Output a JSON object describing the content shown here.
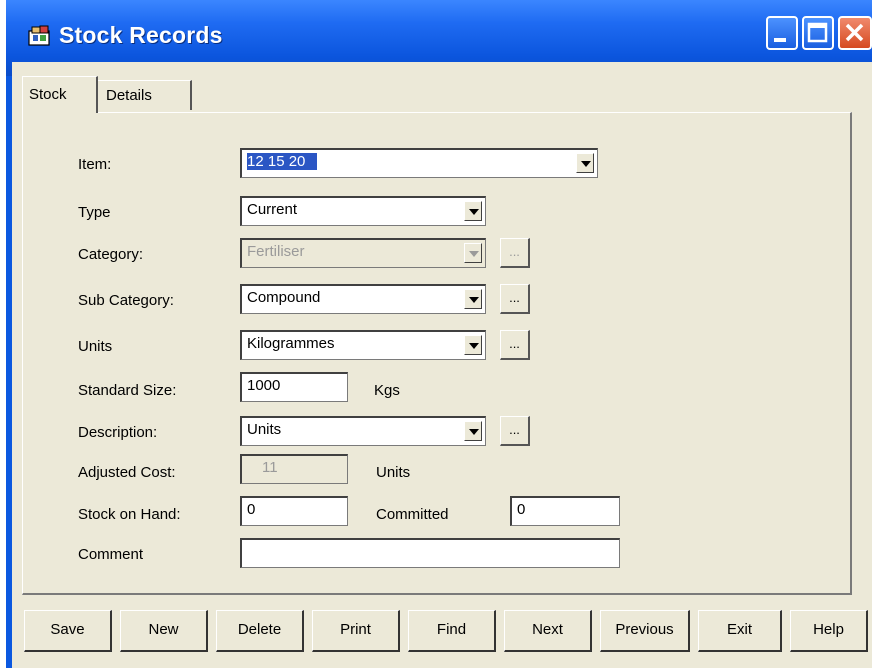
{
  "window": {
    "title": "Stock Records"
  },
  "tabs": [
    {
      "label": "Stock",
      "active": true
    },
    {
      "label": "Details",
      "active": false
    }
  ],
  "form": {
    "item": {
      "label": "Item:",
      "value": "12 15 20"
    },
    "type": {
      "label": "Type",
      "value": "Current"
    },
    "category": {
      "label": "Category:",
      "value": "Fertiliser"
    },
    "sub_category": {
      "label": "Sub Category:",
      "value": "Compound"
    },
    "units": {
      "label": "Units",
      "value": "Kilogrammes"
    },
    "standard_size": {
      "label": "Standard Size:",
      "value": "1000",
      "unit": "Kgs"
    },
    "description": {
      "label": "Description:",
      "value": "Units"
    },
    "adjusted_cost": {
      "label": "Adjusted Cost:",
      "value": "11",
      "unit": "Units"
    },
    "stock_on_hand": {
      "label": "Stock on Hand:",
      "value": "0"
    },
    "committed": {
      "label": "Committed",
      "value": "0"
    },
    "comment": {
      "label": "Comment",
      "value": ""
    },
    "ellipsis": "..."
  },
  "buttons": {
    "save": "Save",
    "new": "New",
    "delete": "Delete",
    "print": "Print",
    "find": "Find",
    "next": "Next",
    "previous": "Previous",
    "exit": "Exit",
    "help": "Help"
  },
  "colors": {
    "titlebar": "#0b55dd",
    "dialog_bg": "#ece9d8",
    "selection": "#2b56c4"
  }
}
